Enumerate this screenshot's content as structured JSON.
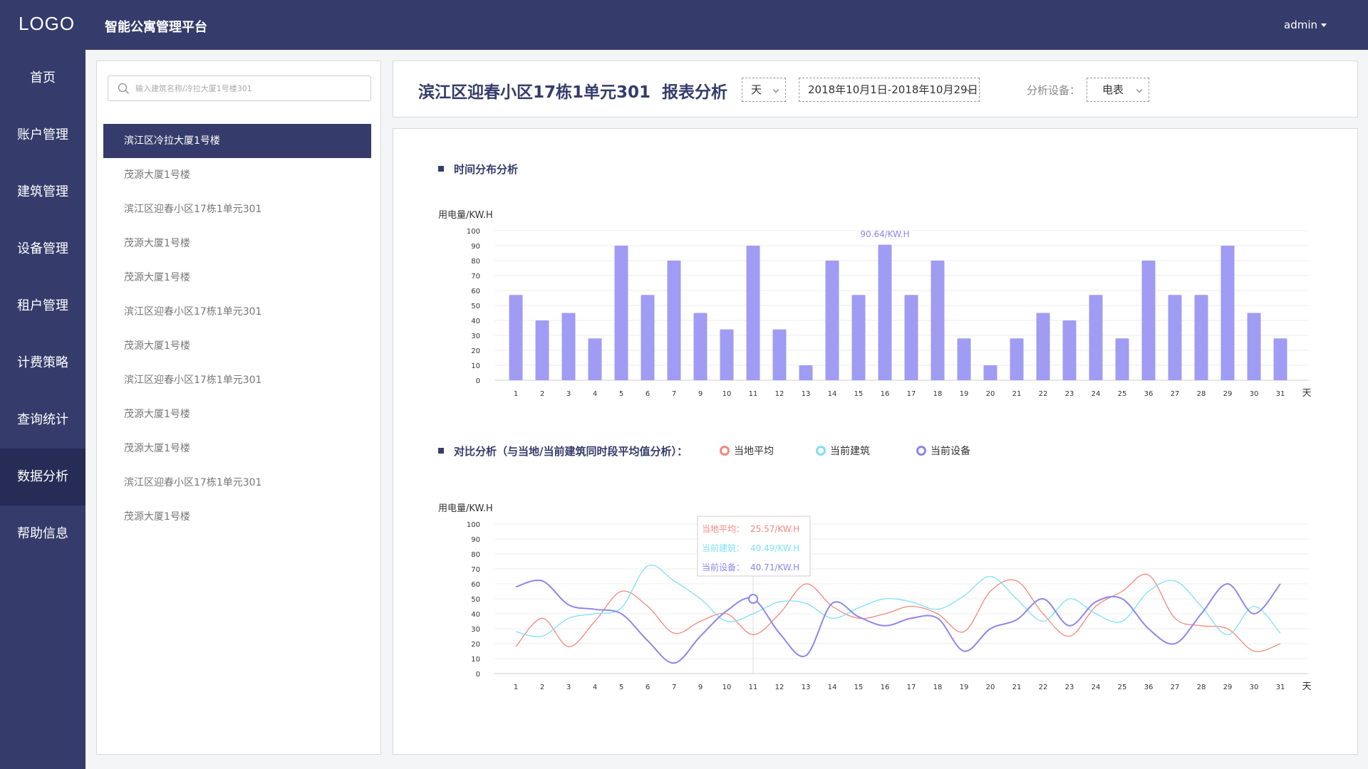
{
  "header": {
    "logo": "LOGO",
    "app_title": "智能公寓管理平台",
    "user": "admin"
  },
  "nav": [
    {
      "label": "首页"
    },
    {
      "label": "账户管理"
    },
    {
      "label": "建筑管理"
    },
    {
      "label": "设备管理"
    },
    {
      "label": "租户管理"
    },
    {
      "label": "计费策略"
    },
    {
      "label": "查询统计"
    },
    {
      "label": "数据分析",
      "active": true
    },
    {
      "label": "帮助信息"
    }
  ],
  "tree": {
    "search_placeholder": "输入建筑名称/冷拉大厦1号楼301",
    "items": [
      {
        "label": "滨江区冷拉大厦1号楼",
        "selected": true
      },
      {
        "label": "茂源大厦1号楼"
      },
      {
        "label": "滨江区迎春小区17栋1单元301"
      },
      {
        "label": "茂源大厦1号楼"
      },
      {
        "label": "茂源大厦1号楼"
      },
      {
        "label": "滨江区迎春小区17栋1单元301"
      },
      {
        "label": "茂源大厦1号楼"
      },
      {
        "label": "滨江区迎春小区17栋1单元301"
      },
      {
        "label": "茂源大厦1号楼"
      },
      {
        "label": "茂源大厦1号楼"
      },
      {
        "label": "滨江区迎春小区17栋1单元301"
      },
      {
        "label": "茂源大厦1号楼"
      }
    ]
  },
  "report": {
    "title": "滨江区迎春小区17栋1单元301  报表分析",
    "period": "天",
    "date_range": "2018年10月1日-2018年10月29日",
    "device_label": "分析设备：",
    "device": "电表"
  },
  "colors": {
    "nav_bg": "#353c6b",
    "bar": "#a09cf3",
    "local_avg": "#f4877b",
    "building": "#7ee0f5",
    "device": "#8c87ea"
  },
  "chart_data": [
    {
      "type": "bar",
      "title": "时间分布分析",
      "ylabel": "用电量/KW.H",
      "xlabel": "天",
      "ylim": [
        0,
        100
      ],
      "yticks": [
        0,
        10,
        20,
        30,
        40,
        50,
        60,
        70,
        80,
        90,
        100
      ],
      "categories": [
        "1",
        "2",
        "3",
        "4",
        "5",
        "6",
        "7",
        "9",
        "10",
        "11",
        "12",
        "13",
        "14",
        "15",
        "16",
        "17",
        "18",
        "19",
        "20",
        "21",
        "22",
        "23",
        "24",
        "25",
        "36",
        "27",
        "28",
        "29",
        "30",
        "31"
      ],
      "values": [
        57,
        40,
        45,
        28,
        90,
        57,
        80,
        45,
        34,
        90,
        34,
        10,
        80,
        57,
        90.64,
        57,
        80,
        28,
        10,
        28,
        45,
        40,
        57,
        28,
        80,
        57,
        57,
        90,
        45,
        28
      ],
      "annotation": {
        "category": "16",
        "text": "90.64/KW.H"
      },
      "grid": true
    },
    {
      "type": "line",
      "title": "对比分析（与当地/当前建筑同时段平均值分析）：",
      "ylabel": "用电量/KW.H",
      "xlabel": "天",
      "ylim": [
        0,
        100
      ],
      "yticks": [
        0,
        10,
        20,
        30,
        40,
        50,
        60,
        70,
        80,
        90,
        100
      ],
      "categories": [
        "1",
        "2",
        "3",
        "4",
        "5",
        "6",
        "7",
        "9",
        "10",
        "11",
        "12",
        "13",
        "14",
        "15",
        "16",
        "17",
        "18",
        "19",
        "20",
        "21",
        "22",
        "23",
        "24",
        "25",
        "36",
        "27",
        "28",
        "29",
        "30",
        "31"
      ],
      "series": [
        {
          "name": "当地平均",
          "color": "#f4877b",
          "values": [
            18,
            37,
            18,
            35,
            55,
            45,
            27,
            35,
            40,
            26,
            40,
            60,
            45,
            37,
            40,
            45,
            40,
            28,
            55,
            62,
            40,
            25,
            45,
            55,
            66,
            37,
            32,
            30,
            15,
            20
          ]
        },
        {
          "name": "当前建筑",
          "color": "#7ee0f5",
          "values": [
            28,
            25,
            37,
            40,
            44,
            72,
            62,
            50,
            35,
            40,
            48,
            47,
            37,
            44,
            50,
            48,
            43,
            52,
            65,
            50,
            35,
            50,
            40,
            35,
            55,
            62,
            45,
            26,
            45,
            27
          ]
        },
        {
          "name": "当前设备",
          "color": "#8c87ea",
          "values": [
            58,
            62,
            46,
            43,
            40,
            22,
            7,
            25,
            42,
            50,
            27,
            12,
            47,
            38,
            32,
            37,
            37,
            15,
            30,
            36,
            50,
            32,
            48,
            50,
            30,
            20,
            40,
            60,
            40,
            60
          ]
        }
      ],
      "tooltip": {
        "category": "11",
        "rows": [
          {
            "label": "当地平均：",
            "value": "25.57/KW.H"
          },
          {
            "label": "当前建筑：",
            "value": "40.49/KW.H"
          },
          {
            "label": "当前设备：",
            "value": "40.71/KW.H"
          }
        ]
      },
      "grid": true
    }
  ]
}
